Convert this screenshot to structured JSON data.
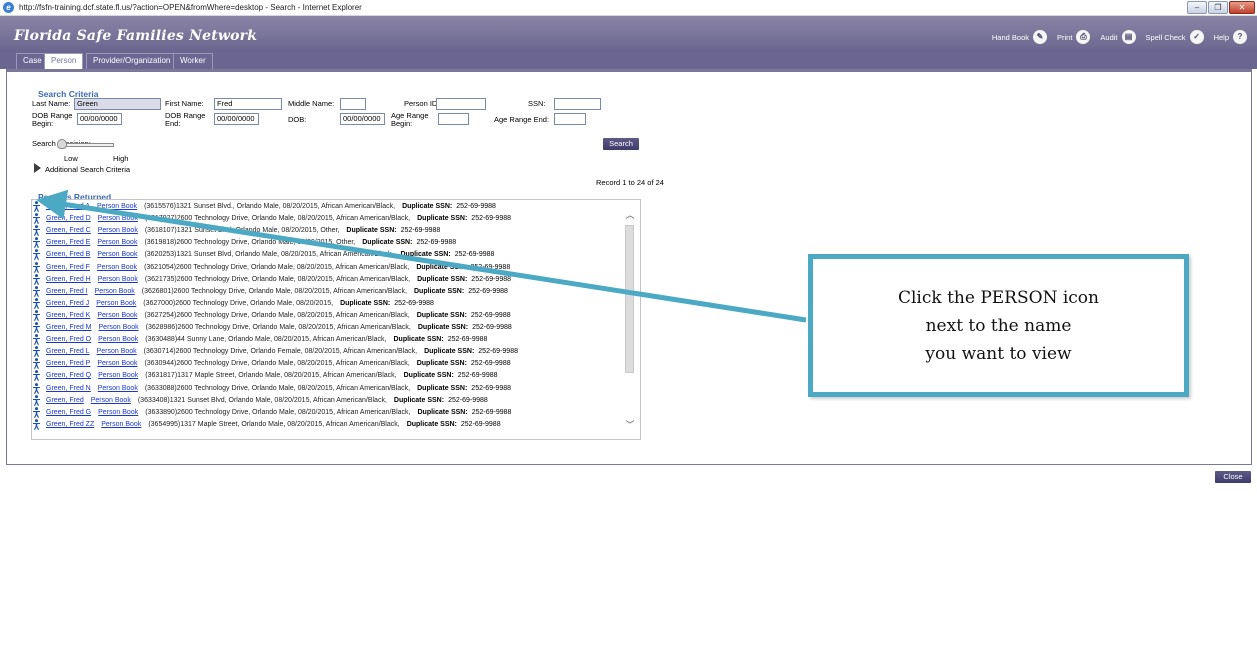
{
  "window": {
    "title": "http://fsfn-training.dcf.state.fl.us/?action=OPEN&fromWhere=desktop - Search - Internet Explorer",
    "buttons": [
      "–",
      "❐",
      "✕"
    ]
  },
  "app": {
    "title": "Florida Safe Families Network",
    "toolbar": [
      {
        "label": "Hand Book",
        "icon": "handbook-icon",
        "glyph": "✎"
      },
      {
        "label": "Print",
        "icon": "printer-icon",
        "glyph": "⎙"
      },
      {
        "label": "Audit",
        "icon": "audit-icon",
        "glyph": "▤"
      },
      {
        "label": "Spell Check",
        "icon": "spellcheck-icon",
        "glyph": "✓"
      },
      {
        "label": "Help",
        "icon": "help-icon",
        "glyph": "?"
      }
    ]
  },
  "tabs": [
    "Case",
    "Person",
    "Provider/Organization",
    "Worker"
  ],
  "active_tab": "Person",
  "search": {
    "section_title": "Search Criteria",
    "last_name_label": "Last Name:",
    "last_name_value": "Green",
    "first_name_label": "First Name:",
    "first_name_value": "Fred",
    "middle_name_label": "Middle Name:",
    "middle_name_value": "",
    "person_id_label": "Person ID:",
    "person_id_value": "",
    "ssn_label": "SSN:",
    "ssn_value": "",
    "dob_begin_label_1": "DOB Range",
    "dob_begin_label_2": "Begin:",
    "dob_begin_value": "00/00/0000",
    "dob_end_label_1": "DOB Range",
    "dob_end_label_2": "End:",
    "dob_end_value": "00/00/0000",
    "dob_label": "DOB:",
    "dob_value": "00/00/0000",
    "age_begin_label_1": "Age Range",
    "age_begin_label_2": "Begin:",
    "age_begin_value": "",
    "age_end_label": "Age Range End:",
    "age_end_value": "",
    "precision_label": "Search Precision:",
    "precision_low": "Low",
    "precision_high": "High",
    "additional_label": "Additional Search Criteria",
    "search_button": "Search"
  },
  "results": {
    "record_count": "Record 1 to 24 of 24",
    "section_title": "Persons Returned",
    "person_book_label": "Person Book",
    "dup_label": "Duplicate SSN:",
    "rows": [
      {
        "name": "Green, Fred A",
        "detail": "(3615576)1321 Sunset Blvd., Orlando  Male,  08/20/2015,  African American/Black,",
        "ssn": "252-69-9988"
      },
      {
        "name": "Green, Fred D",
        "detail": "(3617927)2600 Technology Drive, Orlando  Male,  08/20/2015,  African American/Black,",
        "ssn": "252-69-9988"
      },
      {
        "name": "Green, Fred C",
        "detail": "(3618107)1321 Sunset Blvd, Orlando  Male,  08/20/2015,  Other,",
        "ssn": "252-69-9988"
      },
      {
        "name": "Green, Fred E",
        "detail": "(3619818)2600 Technology Drive, Orlando  Male,  08/20/2015,  Other,",
        "ssn": "252-69-9988"
      },
      {
        "name": "Green, Fred B",
        "detail": "(3620253)1321 Sunset Blvd, Orlando  Male,  08/20/2015,  African American/Black,",
        "ssn": "252-69-9988"
      },
      {
        "name": "Green, Fred F",
        "detail": "(3621054)2600 Technology Drive, Orlando  Male,  08/20/2015,  African American/Black,",
        "ssn": "252-69-9988"
      },
      {
        "name": "Green, Fred H",
        "detail": "(3621735)2600 Technology Drive, Orlando  Male,  08/20/2015,  African American/Black,",
        "ssn": "252-69-9988"
      },
      {
        "name": "Green, Fred I",
        "detail": "(3626801)2600 Technology Drive, Orlando  Male,  08/20/2015,  African American/Black,",
        "ssn": "252-69-9988"
      },
      {
        "name": "Green, Fred J",
        "detail": "(3627000)2600 Technology Drive, Orlando  Male,  08/20/2015,",
        "ssn": "252-69-9988"
      },
      {
        "name": "Green, Fred K",
        "detail": "(3627254)2600 Technology Drive, Orlando  Male,  08/20/2015,  African American/Black,",
        "ssn": "252-69-9988"
      },
      {
        "name": "Green, Fred M",
        "detail": "(3628986)2600 Technology Drive, Orlando  Male,  08/20/2015,  African American/Black,",
        "ssn": "252-69-9988"
      },
      {
        "name": "Green, Fred O",
        "detail": "(3630488)44 Sunny Lane, Orlando  Male,  08/20/2015,  African American/Black,",
        "ssn": "252-69-9988"
      },
      {
        "name": "Green, Fred L",
        "detail": "(3630714)2600 Technology Drive, Orlando  Female,  08/20/2015,  African American/Black,",
        "ssn": "252-69-9988"
      },
      {
        "name": "Green, Fred P",
        "detail": "(3630944)2600 Technology Drive, Orlando  Male,  08/20/2015,  African American/Black,",
        "ssn": "252-69-9988"
      },
      {
        "name": "Green, Fred Q",
        "detail": "(3631817)1317 Maple Street, Orlando  Male,  08/20/2015,  African American/Black,",
        "ssn": "252-69-9988"
      },
      {
        "name": "Green, Fred N",
        "detail": "(3633088)2600 Technology Drive, Orlando  Male,  08/20/2015,  African American/Black,",
        "ssn": "252-69-9988"
      },
      {
        "name": "Green, Fred",
        "detail": "(3633408)1321 Sunset Blvd, Orlando  Male,  08/20/2015,  African American/Black,",
        "ssn": "252-69-9988"
      },
      {
        "name": "Green, Fred G",
        "detail": "(3633890)2600 Technology Drive, Orlando  Male,  08/20/2015,  African American/Black,",
        "ssn": "252-69-9988"
      },
      {
        "name": "Green, Fred ZZ",
        "detail": "(3654995)1317 Maple Street, Orlando  Male,  08/20/2015,  African American/Black,",
        "ssn": "252-69-9988"
      }
    ]
  },
  "close_button": "Close",
  "callout": {
    "line1": "Click the PERSON icon",
    "line2": "next to the name",
    "line3": "you want to view"
  }
}
